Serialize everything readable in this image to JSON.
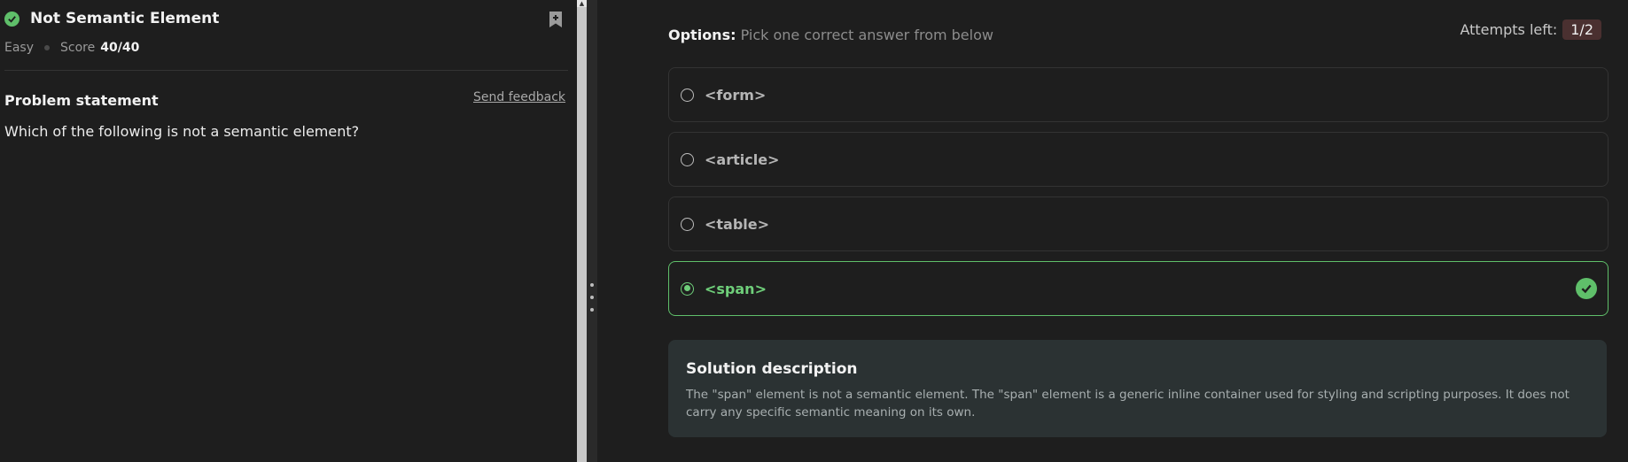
{
  "problem": {
    "title": "Not Semantic Element",
    "difficulty": "Easy",
    "score_label": "Score",
    "score_value": "40/40"
  },
  "statement": {
    "heading": "Problem statement",
    "feedback_link": "Send feedback",
    "question": "Which of the following is not a semantic element?"
  },
  "options_header": {
    "label": "Options:",
    "hint": "Pick one correct answer from below"
  },
  "attempts": {
    "label": "Attempts left:",
    "value": "1/2"
  },
  "options": [
    {
      "label": "<form>",
      "selected": false
    },
    {
      "label": "<article>",
      "selected": false
    },
    {
      "label": "<table>",
      "selected": false
    },
    {
      "label": "<span>",
      "selected": true,
      "correct": true
    }
  ],
  "solution": {
    "title": "Solution description",
    "text": "The \"span\" element is not a semantic element. The \"span\" element is a generic inline container used for styling and scripting purposes. It does not carry any specific semantic meaning on its own."
  },
  "colors": {
    "success": "#5fbf6a",
    "background": "#1e1e1e",
    "solution_bg": "#2b3233"
  },
  "icons": [
    "check-circle-icon",
    "bookmark-add-icon",
    "radio-icon",
    "drag-handle-icon"
  ]
}
